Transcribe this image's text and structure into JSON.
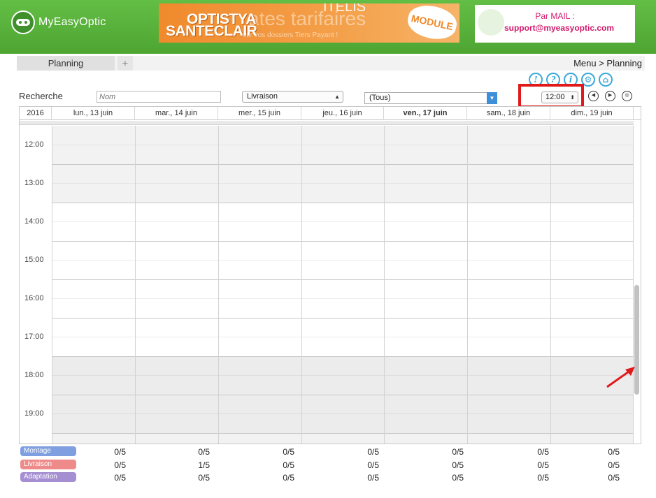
{
  "header": {
    "app_name": "MyEasyOptic",
    "banner": {
      "title_line1": "OPTISTYA",
      "title_line2": "SANTECLAIR",
      "ghost_text": "ates tarifaires",
      "top_text": "ITELIS",
      "sub_text": "sur vos dossiers Tiers Payant !",
      "badge": "MODULE"
    },
    "support": {
      "label": "Par MAIL :",
      "email": "support@myeasyoptic.com"
    }
  },
  "tabs": {
    "active": "Planning",
    "add": "+"
  },
  "breadcrumb": "Menu > Planning",
  "toolbar_icons": [
    "!",
    "?",
    "i",
    "⚙",
    "⌂"
  ],
  "search": {
    "label": "Recherche",
    "name_placeholder": "Nom",
    "type_value": "Livraison",
    "filter_value": "(Tous)",
    "time_value": "12:00"
  },
  "calendar": {
    "year": "2016",
    "days": [
      {
        "label": "lun., 13 juin",
        "today": false
      },
      {
        "label": "mar., 14 juin",
        "today": false
      },
      {
        "label": "mer., 15 juin",
        "today": false
      },
      {
        "label": "jeu., 16 juin",
        "today": false
      },
      {
        "label": "ven., 17 juin",
        "today": true
      },
      {
        "label": "sam., 18 juin",
        "today": false
      },
      {
        "label": "dim., 19 juin",
        "today": false
      }
    ],
    "hours": [
      "12:00",
      "13:00",
      "14:00",
      "15:00",
      "16:00",
      "17:00",
      "18:00",
      "19:00"
    ]
  },
  "counters": [
    {
      "label": "Montage",
      "color": "#7f9fe0",
      "values": [
        "0/5",
        "0/5",
        "0/5",
        "0/5",
        "0/5",
        "0/5",
        "0/5"
      ]
    },
    {
      "label": "Livraison",
      "color": "#ee8a8a",
      "values": [
        "0/5",
        "1/5",
        "0/5",
        "0/5",
        "0/5",
        "0/5",
        "0/5"
      ]
    },
    {
      "label": "Adaptation",
      "color": "#a58fd2",
      "values": [
        "0/5",
        "0/5",
        "0/5",
        "0/5",
        "0/5",
        "0/5",
        "0/5"
      ]
    }
  ],
  "colors": {
    "header_green": "#56b13a",
    "accent_blue": "#3da9d9",
    "highlight_red": "#e01a1a"
  }
}
